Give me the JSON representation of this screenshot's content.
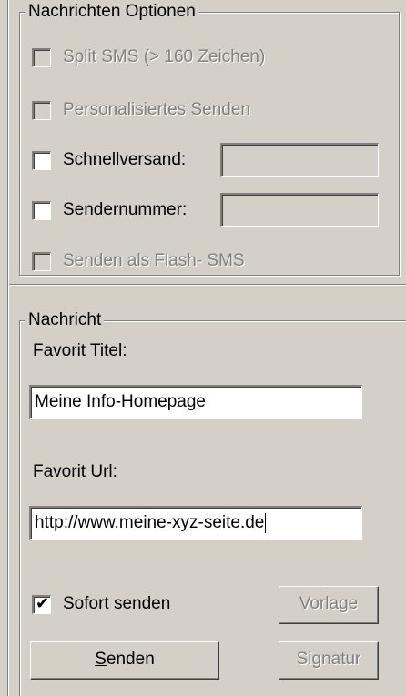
{
  "options_group": {
    "legend": "Nachrichten Optionen",
    "split_sms": {
      "label": "Split SMS (> 160 Zeichen)",
      "checked": false,
      "enabled": false
    },
    "personalized": {
      "label": "Personalisiertes Senden",
      "checked": false,
      "enabled": false
    },
    "express": {
      "label": "Schnellversand:",
      "checked": false,
      "enabled": true,
      "value": ""
    },
    "sender_number": {
      "label": "Sendernummer:",
      "checked": false,
      "enabled": true,
      "value": ""
    },
    "flash_sms": {
      "label": "Senden als Flash- SMS",
      "checked": false,
      "enabled": false
    }
  },
  "message_group": {
    "legend": "Nachricht",
    "title_label": "Favorit Titel:",
    "title_value": "Meine Info-Homepage",
    "url_label": "Favorit Url:",
    "url_value": "http://www.meine-xyz-seite.de",
    "send_now": {
      "label": "Sofort senden",
      "checked": true
    },
    "template_button": "Vorlage",
    "send_button_mnemonic": "S",
    "send_button_rest": "enden",
    "signature_button": "Signatur"
  }
}
